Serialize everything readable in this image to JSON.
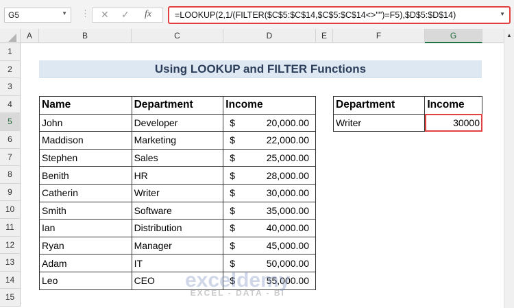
{
  "name_box": "G5",
  "formula": "=LOOKUP(2,1/(FILTER($C$5:$C$14,$C$5:$C$14<>\"\")=F5),$D$5:$D$14)",
  "columns": [
    "A",
    "B",
    "C",
    "D",
    "E",
    "F",
    "G"
  ],
  "rows": [
    "1",
    "2",
    "3",
    "4",
    "5",
    "6",
    "7",
    "8",
    "9",
    "10",
    "11",
    "12",
    "13",
    "14",
    "15"
  ],
  "title": "Using LOOKUP and FILTER Functions",
  "table": {
    "headers": [
      "Name",
      "Department",
      "Income"
    ],
    "rows": [
      [
        "John",
        "Developer",
        "$",
        "20,000.00"
      ],
      [
        "Maddison",
        "Marketing",
        "$",
        "22,000.00"
      ],
      [
        "Stephen",
        "Sales",
        "$",
        "25,000.00"
      ],
      [
        "Benith",
        "HR",
        "$",
        "28,000.00"
      ],
      [
        "Catherin",
        "Writer",
        "$",
        "30,000.00"
      ],
      [
        "Smith",
        "Software",
        "$",
        "35,000.00"
      ],
      [
        "Ian",
        "Distribution",
        "$",
        "40,000.00"
      ],
      [
        "Ryan",
        "Manager",
        "$",
        "45,000.00"
      ],
      [
        "Adam",
        "IT",
        "$",
        "50,000.00"
      ],
      [
        "Leo",
        "CEO",
        "$",
        "55,000.00"
      ]
    ]
  },
  "lookup": {
    "headers": [
      "Department",
      "Income"
    ],
    "department": "Writer",
    "income": "30000"
  },
  "watermark": {
    "brand": "exceldemy",
    "tagline": "EXCEL - DATA - BI"
  }
}
